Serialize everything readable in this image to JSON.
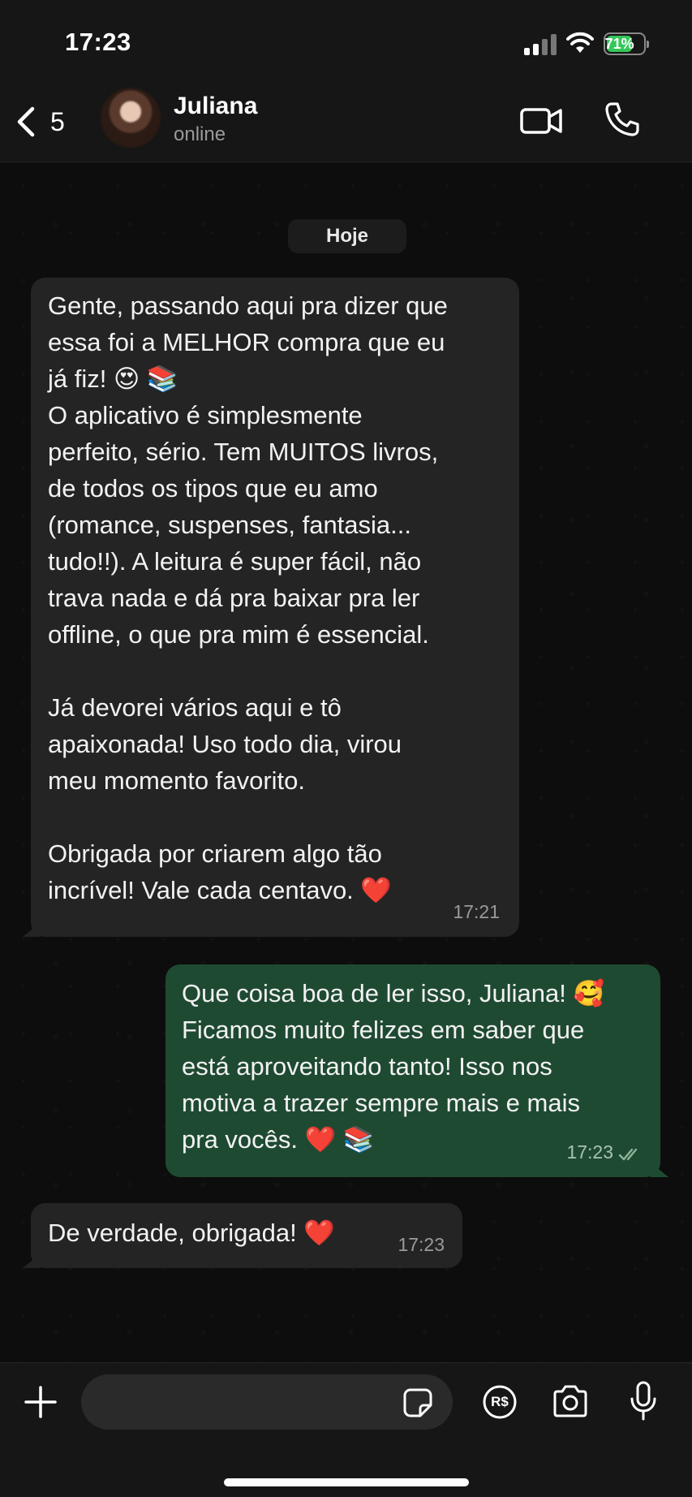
{
  "status_bar": {
    "time": "17:23",
    "battery": "71%",
    "signal_icon": "cellular-signal-icon",
    "wifi_icon": "wifi-icon",
    "battery_icon": "battery-icon"
  },
  "header": {
    "back_count": "5",
    "contact_name": "Juliana",
    "contact_status": "online",
    "icons": [
      "chevron-left-icon",
      "video-camera-icon",
      "phone-icon"
    ]
  },
  "chat": {
    "date_label": "Hoje",
    "messages": [
      {
        "direction": "incoming",
        "text": "Gente, passando aqui pra dizer que\nessa foi a MELHOR compra que eu\njá fiz! 😍 📚\nO aplicativo é simplesmente\nperfeito, sério. Tem MUITOS livros,\nde todos os tipos que eu amo\n(romance, suspenses, fantasia...\ntudo!!). A leitura é super fácil, não\ntrava nada e dá pra baixar pra ler\noffline, o que pra mim é essencial.\n\nJá devorei vários aqui e tô\napaixonada! Uso todo dia, virou\nmeu momento favorito.\n\nObrigada por criarem algo tão\nincrível! Vale cada centavo. ❤️",
        "time": "17:21"
      },
      {
        "direction": "outgoing",
        "text": "Que coisa boa de ler isso, Juliana! 🥰\nFicamos muito felizes em saber que\nestá aproveitando tanto! Isso nos\nmotiva a trazer sempre mais e mais\npra vocês. ❤️ 📚",
        "time": "17:23",
        "status": "read"
      },
      {
        "direction": "incoming",
        "text": "De verdade, obrigada! ❤️",
        "time": "17:23"
      }
    ]
  },
  "input_bar": {
    "placeholder": "",
    "pay_symbol": "R$",
    "icons": [
      "plus-icon",
      "sticker-icon",
      "payment-icon",
      "camera-icon",
      "microphone-icon"
    ]
  },
  "colors": {
    "background": "#0d0d0d",
    "bar": "#161616",
    "incoming_bubble": "#242424",
    "outgoing_bubble": "#1f4a32",
    "battery_fill": "#34c759"
  }
}
